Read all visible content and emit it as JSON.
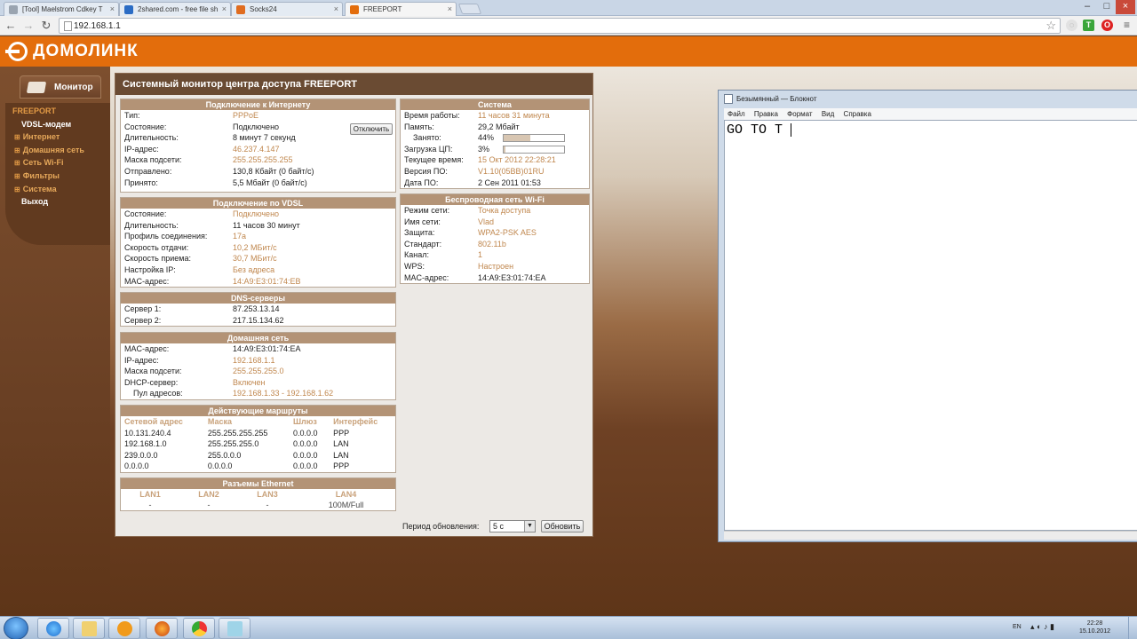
{
  "browser": {
    "tabs": [
      {
        "label": "[Tool] Maelstrom Cdkey T",
        "active": false,
        "color": "#9aa4b0"
      },
      {
        "label": "2shared.com - free file sh",
        "active": false,
        "color": "#2b6cc4"
      },
      {
        "label": "Socks24",
        "active": false,
        "color": "#e06c1f"
      },
      {
        "label": "FREEPORT",
        "active": true,
        "color": "#e36d0c"
      }
    ],
    "url": "192.168.1.1"
  },
  "brand": {
    "name": "ДОМОЛИНК",
    "accent": "#e36d0c"
  },
  "sidebar": {
    "tab_label": "Монитор",
    "items": [
      {
        "label": "FREEPORT",
        "kind": "l1"
      },
      {
        "label": "VDSL-модем",
        "kind": "l2"
      },
      {
        "label": "Интернет",
        "kind": "exp"
      },
      {
        "label": "Домашняя сеть",
        "kind": "exp"
      },
      {
        "label": "Сеть Wi-Fi",
        "kind": "exp"
      },
      {
        "label": "Фильтры",
        "kind": "exp"
      },
      {
        "label": "Система",
        "kind": "exp"
      },
      {
        "label": "Выход",
        "kind": "plain"
      }
    ]
  },
  "panel": {
    "title": "Системный монитор центра доступа FREEPORT",
    "internet": {
      "title": "Подключение к Интернету",
      "disconnect_label": "Отключить",
      "rows": [
        {
          "k": "Тип:",
          "v": "PPPoE",
          "o": true
        },
        {
          "k": "Состояние:",
          "v": "Подключено",
          "o": false
        },
        {
          "k": "Длительность:",
          "v": "8 минут 7 секунд",
          "o": false
        },
        {
          "k": "IP-адрес:",
          "v": "46.237.4.147",
          "o": true
        },
        {
          "k": "Маска подсети:",
          "v": "255.255.255.255",
          "o": true
        },
        {
          "k": "Отправлено:",
          "v": "130,8 Кбайт (0 байт/с)",
          "o": false
        },
        {
          "k": "Принято:",
          "v": "5,5 Мбайт (0 байт/с)",
          "o": false
        }
      ]
    },
    "vdsl": {
      "title": "Подключение по VDSL",
      "rows": [
        {
          "k": "Состояние:",
          "v": "Подключено",
          "o": true
        },
        {
          "k": "Длительность:",
          "v": "11 часов 30 минут",
          "o": false
        },
        {
          "k": "Профиль соединения:",
          "v": "17a",
          "o": true
        },
        {
          "k": "Скорость отдачи:",
          "v": "10,2 МБит/с",
          "o": true
        },
        {
          "k": "Скорость приема:",
          "v": "30,7 МБит/с",
          "o": true
        },
        {
          "k": "Настройка IP:",
          "v": "Без адреса",
          "o": true
        },
        {
          "k": "MAC-адрес:",
          "v": "14:A9:E3:01:74:EB",
          "o": true
        }
      ]
    },
    "dns": {
      "title": "DNS-серверы",
      "rows": [
        {
          "k": "Сервер 1:",
          "v": "87.253.13.14",
          "o": false
        },
        {
          "k": "Сервер 2:",
          "v": "217.15.134.62",
          "o": false
        }
      ]
    },
    "home": {
      "title": "Домашняя сеть",
      "rows": [
        {
          "k": "MAC-адрес:",
          "v": "14:A9:E3:01:74:EA",
          "o": false
        },
        {
          "k": "IP-адрес:",
          "v": "192.168.1.1",
          "o": true
        },
        {
          "k": "Маска подсети:",
          "v": "255.255.255.0",
          "o": true
        },
        {
          "k": "DHCP-сервер:",
          "v": "Включен",
          "o": true
        },
        {
          "k": "Пул адресов:",
          "v": "192.168.1.33 - 192.168.1.62",
          "o": true,
          "ind": true
        }
      ]
    },
    "routes": {
      "title": "Действующие маршруты",
      "headers": [
        "Сетевой адрес",
        "Маска",
        "Шлюз",
        "Интерфейс"
      ],
      "rows": [
        [
          "10.131.240.4",
          "255.255.255.255",
          "0.0.0.0",
          "PPP"
        ],
        [
          "192.168.1.0",
          "255.255.255.0",
          "0.0.0.0",
          "LAN"
        ],
        [
          "239.0.0.0",
          "255.0.0.0",
          "0.0.0.0",
          "LAN"
        ],
        [
          "0.0.0.0",
          "0.0.0.0",
          "0.0.0.0",
          "PPP"
        ]
      ]
    },
    "ethernet": {
      "title": "Разъемы Ethernet",
      "headers": [
        "LAN1",
        "LAN2",
        "LAN3",
        "LAN4"
      ],
      "values": [
        "-",
        "-",
        "-",
        "100M/Full"
      ]
    },
    "system": {
      "title": "Система",
      "rows": [
        {
          "k": "Время работы:",
          "v": "11 часов 31 минута",
          "o": true
        },
        {
          "k": "Память:",
          "v": "29,2 Мбайт",
          "o": false
        },
        {
          "k": "Занято:",
          "v": "44%",
          "o": false,
          "ind": true,
          "bar": 0.44
        },
        {
          "k": "Загрузка ЦП:",
          "v": "3%",
          "o": false,
          "bar": 0.03
        },
        {
          "k": "Текущее время:",
          "v": "15 Окт 2012 22:28:21",
          "o": true
        },
        {
          "k": "Версия ПО:",
          "v": "V1.10(05BB)01RU",
          "o": true
        },
        {
          "k": "Дата ПО:",
          "v": "2 Сен 2011 01:53",
          "o": false
        }
      ]
    },
    "wifi": {
      "title": "Беспроводная сеть Wi-Fi",
      "rows": [
        {
          "k": "Режим сети:",
          "v": "Точка доступа",
          "o": true
        },
        {
          "k": "Имя сети:",
          "v": "Vlad",
          "o": true
        },
        {
          "k": "Защита:",
          "v": "WPA2-PSK AES",
          "o": true
        },
        {
          "k": "Стандарт:",
          "v": "802.11b",
          "o": true
        },
        {
          "k": "Канал:",
          "v": "1",
          "o": true
        },
        {
          "k": "WPS:",
          "v": "Настроен",
          "o": true
        },
        {
          "k": "MAC-адрес:",
          "v": "14:A9:E3:01:74:EA",
          "o": false
        }
      ]
    },
    "refresh": {
      "label": "Период обновления:",
      "value": "5 с",
      "button": "Обновить"
    }
  },
  "notepad": {
    "title": "Безымянный — Блокнот",
    "menu": [
      "Файл",
      "Правка",
      "Формат",
      "Вид",
      "Справка"
    ],
    "text": "GO TO T"
  },
  "taskbar": {
    "lang": "EN",
    "time": "22:28",
    "date": "15.10.2012"
  }
}
